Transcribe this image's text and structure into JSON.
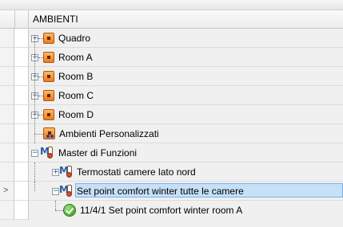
{
  "grid": {
    "column_header": "AMBIENTI",
    "current_row_marker": ">",
    "rows": [
      {
        "label": "Quadro",
        "icon": "room-icon",
        "expander": "+"
      },
      {
        "label": "Room A",
        "icon": "room-icon",
        "expander": "+"
      },
      {
        "label": "Room B",
        "icon": "room-icon",
        "expander": "+"
      },
      {
        "label": "Room C",
        "icon": "room-icon",
        "expander": "+"
      },
      {
        "label": "Room D",
        "icon": "room-icon",
        "expander": "+"
      },
      {
        "label": "Ambienti Personalizzati",
        "icon": "custom-rooms-icon",
        "expander": ""
      },
      {
        "label": "Master di Funzioni",
        "icon": "function-master-icon",
        "expander": "−"
      },
      {
        "label": "Termostati camere lato nord",
        "icon": "function-master-icon",
        "expander": "+"
      },
      {
        "label": "Set point comfort winter tutte le camere",
        "icon": "function-master-icon",
        "expander": "−",
        "selected": true
      },
      {
        "label": "11/4/1 Set point comfort winter room A",
        "icon": "check-icon",
        "expander": ""
      }
    ]
  },
  "colors": {
    "selection_bg": "#c6e0f7",
    "selection_border": "#7db3e6",
    "room_icon": "#f07a1a"
  }
}
